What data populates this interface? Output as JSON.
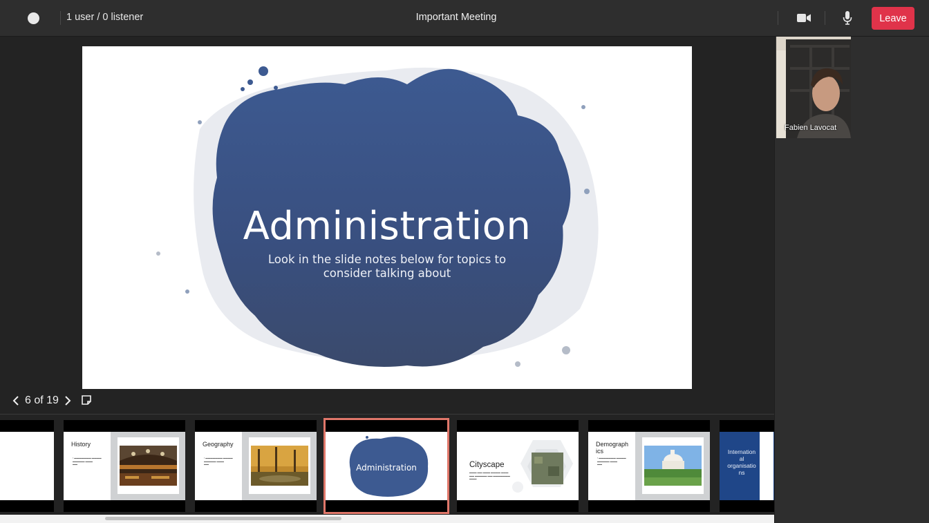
{
  "topbar": {
    "user_count": "1 user / 0 listener",
    "meeting_title": "Important Meeting",
    "leave_label": "Leave",
    "icons": [
      "record-dot",
      "camera-icon",
      "mic-icon"
    ],
    "colors": {
      "leave": "#e0334a",
      "bar": "#2e2e2e"
    }
  },
  "slide": {
    "title": "Administration",
    "subtitle": "Look in the slide notes below for topics to consider talking about",
    "blob_color": "#3e5a8c"
  },
  "navigation": {
    "position": "6 of 19",
    "icons": [
      "chevron-left-icon",
      "chevron-right-icon",
      "notes-icon"
    ]
  },
  "thumbnails": [
    {
      "title": "",
      "selected": false
    },
    {
      "title": "History",
      "selected": false
    },
    {
      "title": "Geography",
      "selected": false
    },
    {
      "title": "Administration",
      "selected": true
    },
    {
      "title": "Cityscape",
      "selected": false
    },
    {
      "title": "Demographics",
      "selected": false
    },
    {
      "title": "International organisations",
      "selected": false
    }
  ],
  "participants": [
    {
      "name": "Fabien Lavocat"
    }
  ],
  "selection_color": "#e0776a"
}
